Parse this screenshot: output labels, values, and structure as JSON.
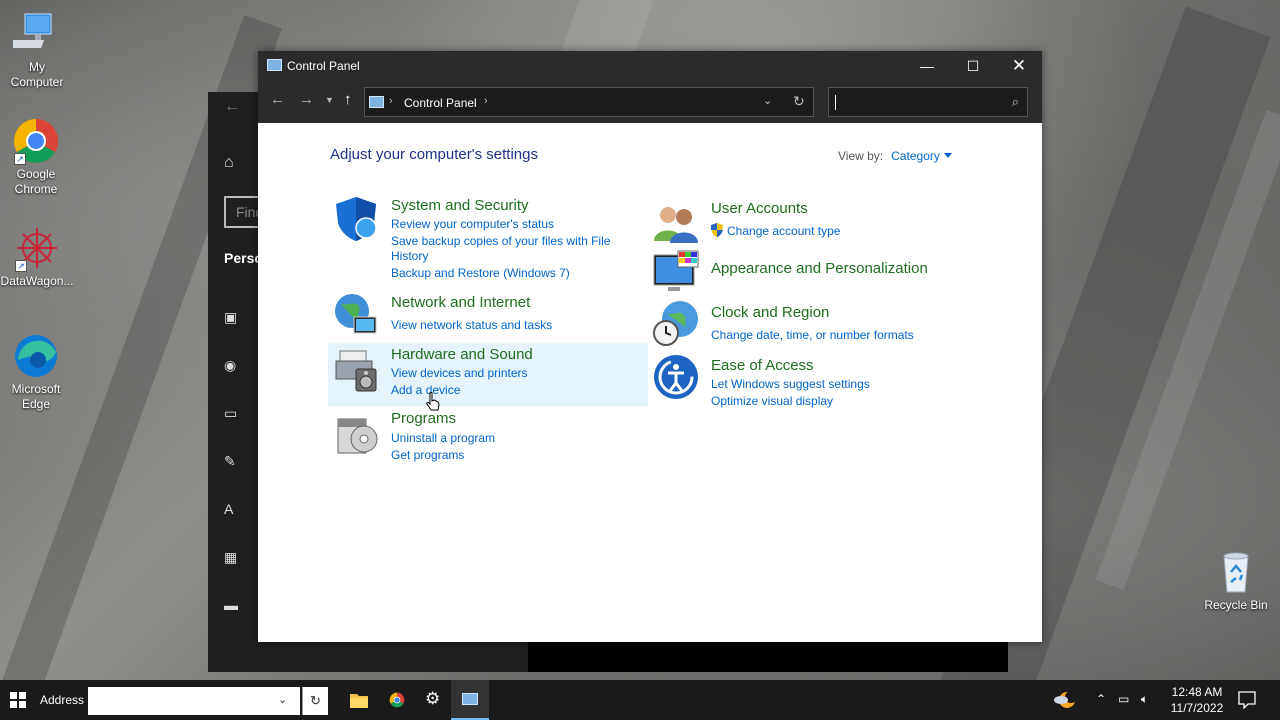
{
  "desktop": {
    "icons": [
      {
        "label": "My\nComputer",
        "l1": "My",
        "l2": "Computer"
      },
      {
        "l1": "Google",
        "l2": "Chrome"
      },
      {
        "l1": "DataWagon...",
        "l2": ""
      },
      {
        "l1": "Microsoft",
        "l2": "Edge"
      },
      {
        "l1": "Recycle Bin",
        "l2": ""
      }
    ]
  },
  "settings_window": {
    "search_partial": "Find",
    "section_partial": "Perso"
  },
  "window": {
    "title": "Control Panel",
    "address_crumb": "Control Panel",
    "search_value": ""
  },
  "content": {
    "heading": "Adjust your computer's settings",
    "view_by_label": "View by:",
    "view_by_value": "Category",
    "categories": [
      {
        "title": "System and Security",
        "links": [
          "Review your computer's status",
          "Save backup copies of your files with File",
          "History",
          "Backup and Restore (Windows 7)"
        ],
        "icon": "shield-icon"
      },
      {
        "title": "Network and Internet",
        "links": [
          "View network status and tasks"
        ],
        "icon": "network-globe-icon"
      },
      {
        "title": "Hardware and Sound",
        "links": [
          "View devices and printers",
          "Add a device"
        ],
        "icon": "printer-speaker-icon"
      },
      {
        "title": "Programs",
        "links": [
          "Uninstall a program",
          "Get programs"
        ],
        "icon": "programs-disc-icon"
      },
      {
        "title": "User Accounts",
        "links": [
          "Change account type"
        ],
        "icon": "users-icon"
      },
      {
        "title": "Appearance and Personalization",
        "links": [],
        "icon": "monitor-palette-icon"
      },
      {
        "title": "Clock and Region",
        "links": [
          "Change date, time, or number formats"
        ],
        "icon": "clock-globe-icon"
      },
      {
        "title": "Ease of Access",
        "links": [
          "Let Windows suggest settings",
          "Optimize visual display"
        ],
        "icon": "ease-of-access-icon"
      }
    ]
  },
  "taskbar": {
    "address_label": "Address",
    "address_value": "",
    "time": "12:48 AM",
    "date": "11/7/2022"
  },
  "colors": {
    "category_title": "#1f6e1f",
    "link": "#0066cc",
    "heading": "#1e3287",
    "title_bar": "#2b2b2b",
    "hover_row": "#e5f3fb"
  }
}
